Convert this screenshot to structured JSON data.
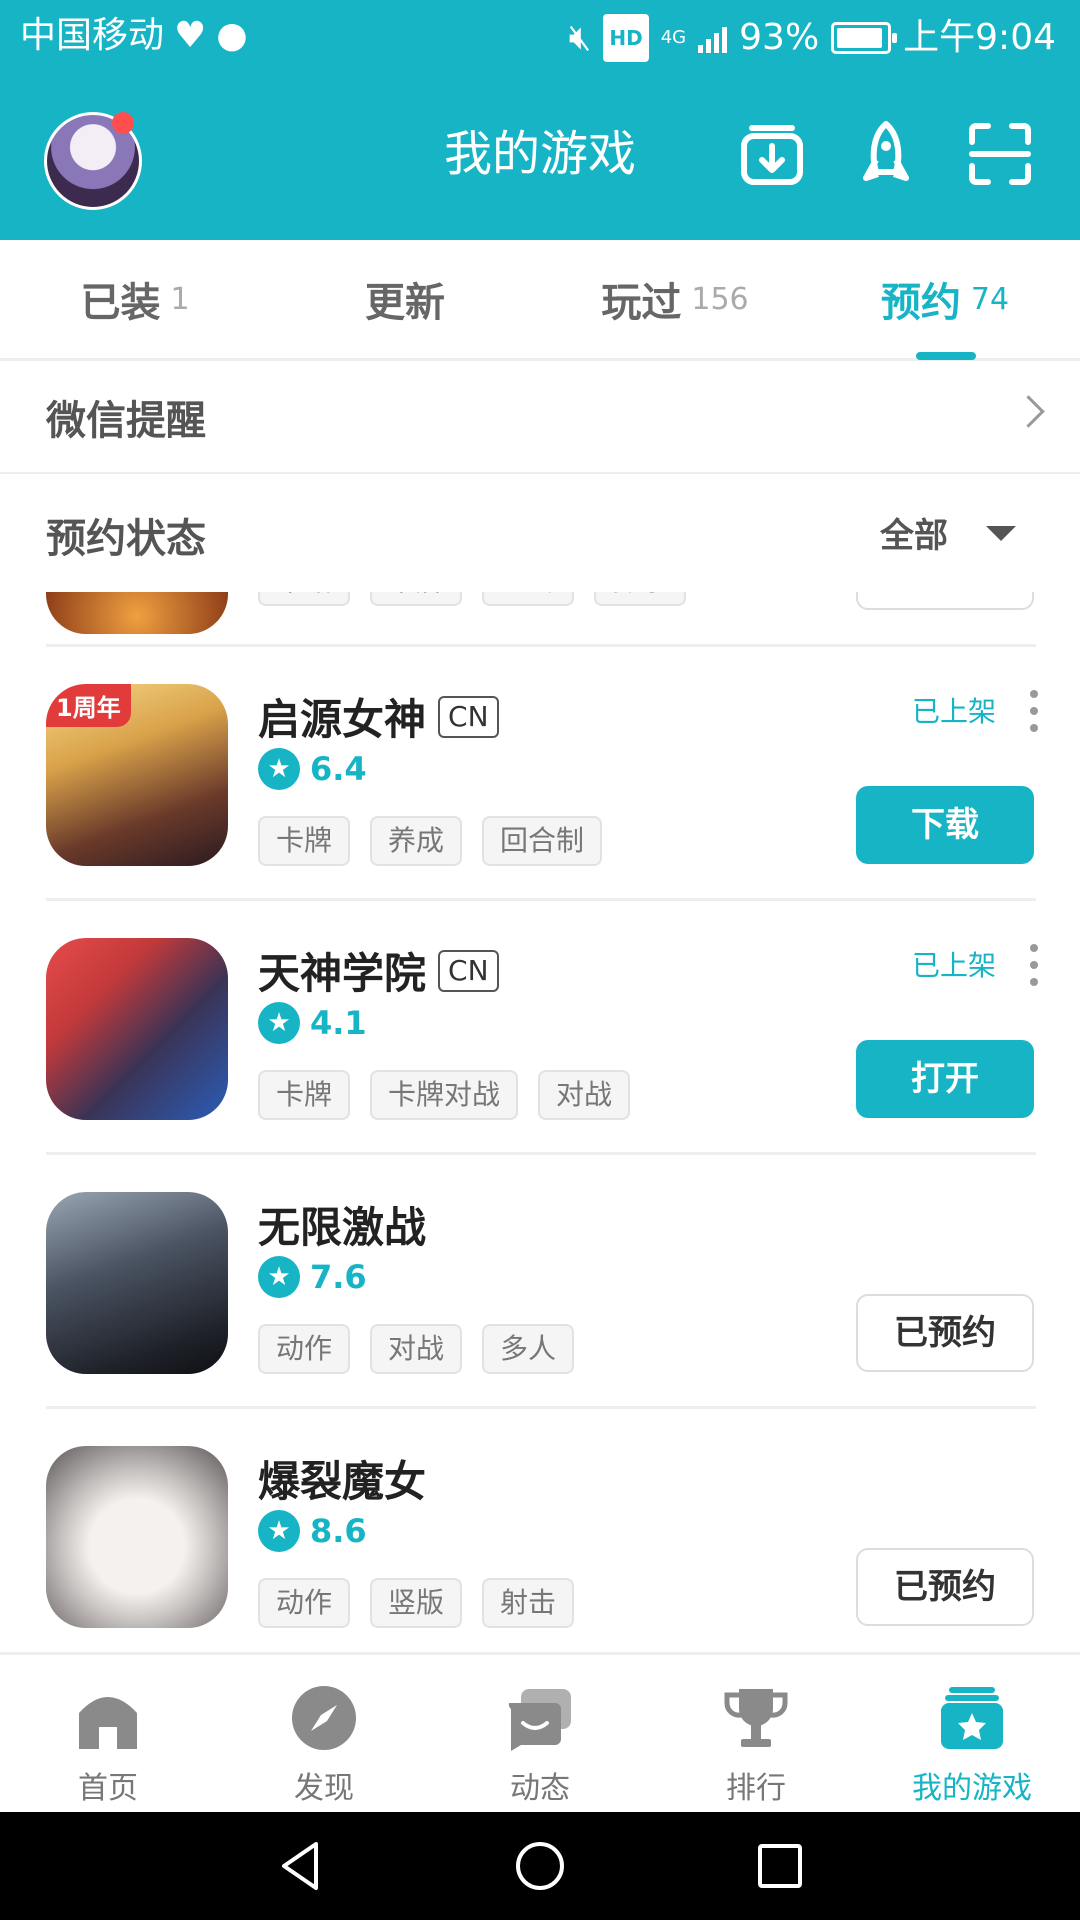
{
  "status_bar": {
    "carrier": "中国移动",
    "network": "4G",
    "hd": "HD",
    "battery_percent": "93%",
    "battery_level": 0.93,
    "time": "上午9:04"
  },
  "header": {
    "title": "我的游戏",
    "icons": [
      "download-icon",
      "rocket-icon",
      "scan-icon"
    ]
  },
  "tabs": [
    {
      "label": "已装",
      "count": "1",
      "active": false
    },
    {
      "label": "更新",
      "count": "",
      "active": false
    },
    {
      "label": "玩过",
      "count": "156",
      "active": false
    },
    {
      "label": "预约",
      "count": "74",
      "active": true
    }
  ],
  "wechat_row": {
    "label": "微信提醒"
  },
  "reservation_status": {
    "label": "预约状态",
    "filter": "全部"
  },
  "partial_item": {
    "tags": [
      "策略",
      "卡牌",
      "经济",
      "探索"
    ]
  },
  "games": [
    {
      "name": "启源女神",
      "region": "CN",
      "rating": "6.4",
      "tags": [
        "卡牌",
        "养成",
        "回合制"
      ],
      "status": "已上架",
      "button": "下载",
      "button_style": "primary",
      "badge": "1周年"
    },
    {
      "name": "天神学院",
      "region": "CN",
      "rating": "4.1",
      "tags": [
        "卡牌",
        "卡牌对战",
        "对战"
      ],
      "status": "已上架",
      "button": "打开",
      "button_style": "primary",
      "badge": ""
    },
    {
      "name": "无限激战",
      "region": "",
      "rating": "7.6",
      "tags": [
        "动作",
        "对战",
        "多人"
      ],
      "status": "",
      "button": "已预约",
      "button_style": "outline",
      "badge": ""
    },
    {
      "name": "爆裂魔女",
      "region": "",
      "rating": "8.6",
      "tags": [
        "动作",
        "竖版",
        "射击"
      ],
      "status": "",
      "button": "已预约",
      "button_style": "outline",
      "badge": ""
    }
  ],
  "bottom_nav": [
    {
      "label": "首页",
      "icon": "home-icon",
      "active": false
    },
    {
      "label": "发现",
      "icon": "compass-icon",
      "active": false
    },
    {
      "label": "动态",
      "icon": "chat-icon",
      "active": false
    },
    {
      "label": "排行",
      "icon": "trophy-icon",
      "active": false
    },
    {
      "label": "我的游戏",
      "icon": "my-games-icon",
      "active": true
    }
  ],
  "colors": {
    "accent": "#17b4c6",
    "notification_dot": "#ff4e4e"
  }
}
